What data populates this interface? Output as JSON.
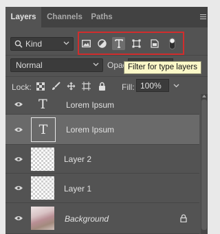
{
  "tabs": [
    "Layers",
    "Channels",
    "Paths"
  ],
  "filter": {
    "kind_label": "Kind",
    "buttons": [
      "pixel-layers-filter",
      "adjustment-layers-filter",
      "type-layers-filter",
      "shape-layers-filter",
      "smart-objects-filter",
      "filtering-toggle"
    ]
  },
  "tooltip": "Filter for type layers",
  "blend": {
    "mode": "Normal",
    "opacity_label": "Opac"
  },
  "lock": {
    "label": "Lock:",
    "fill_label": "Fill:",
    "fill_value": "100%"
  },
  "layers": [
    {
      "name": "Lorem Ipsum",
      "type": "text",
      "visible": true,
      "selected": false
    },
    {
      "name": "Lorem Ipsum",
      "type": "text",
      "visible": true,
      "selected": true
    },
    {
      "name": "Layer 2",
      "type": "pixel",
      "visible": true,
      "selected": false
    },
    {
      "name": "Layer 1",
      "type": "pixel",
      "visible": true,
      "selected": false
    },
    {
      "name": "Background",
      "type": "background",
      "visible": true,
      "selected": false,
      "locked": true
    }
  ],
  "colors": {
    "panel_bg": "#535353",
    "highlight_box": "#d22d2d",
    "tooltip_bg": "#fbf8c8",
    "selected_row": "#6a6a6a"
  }
}
